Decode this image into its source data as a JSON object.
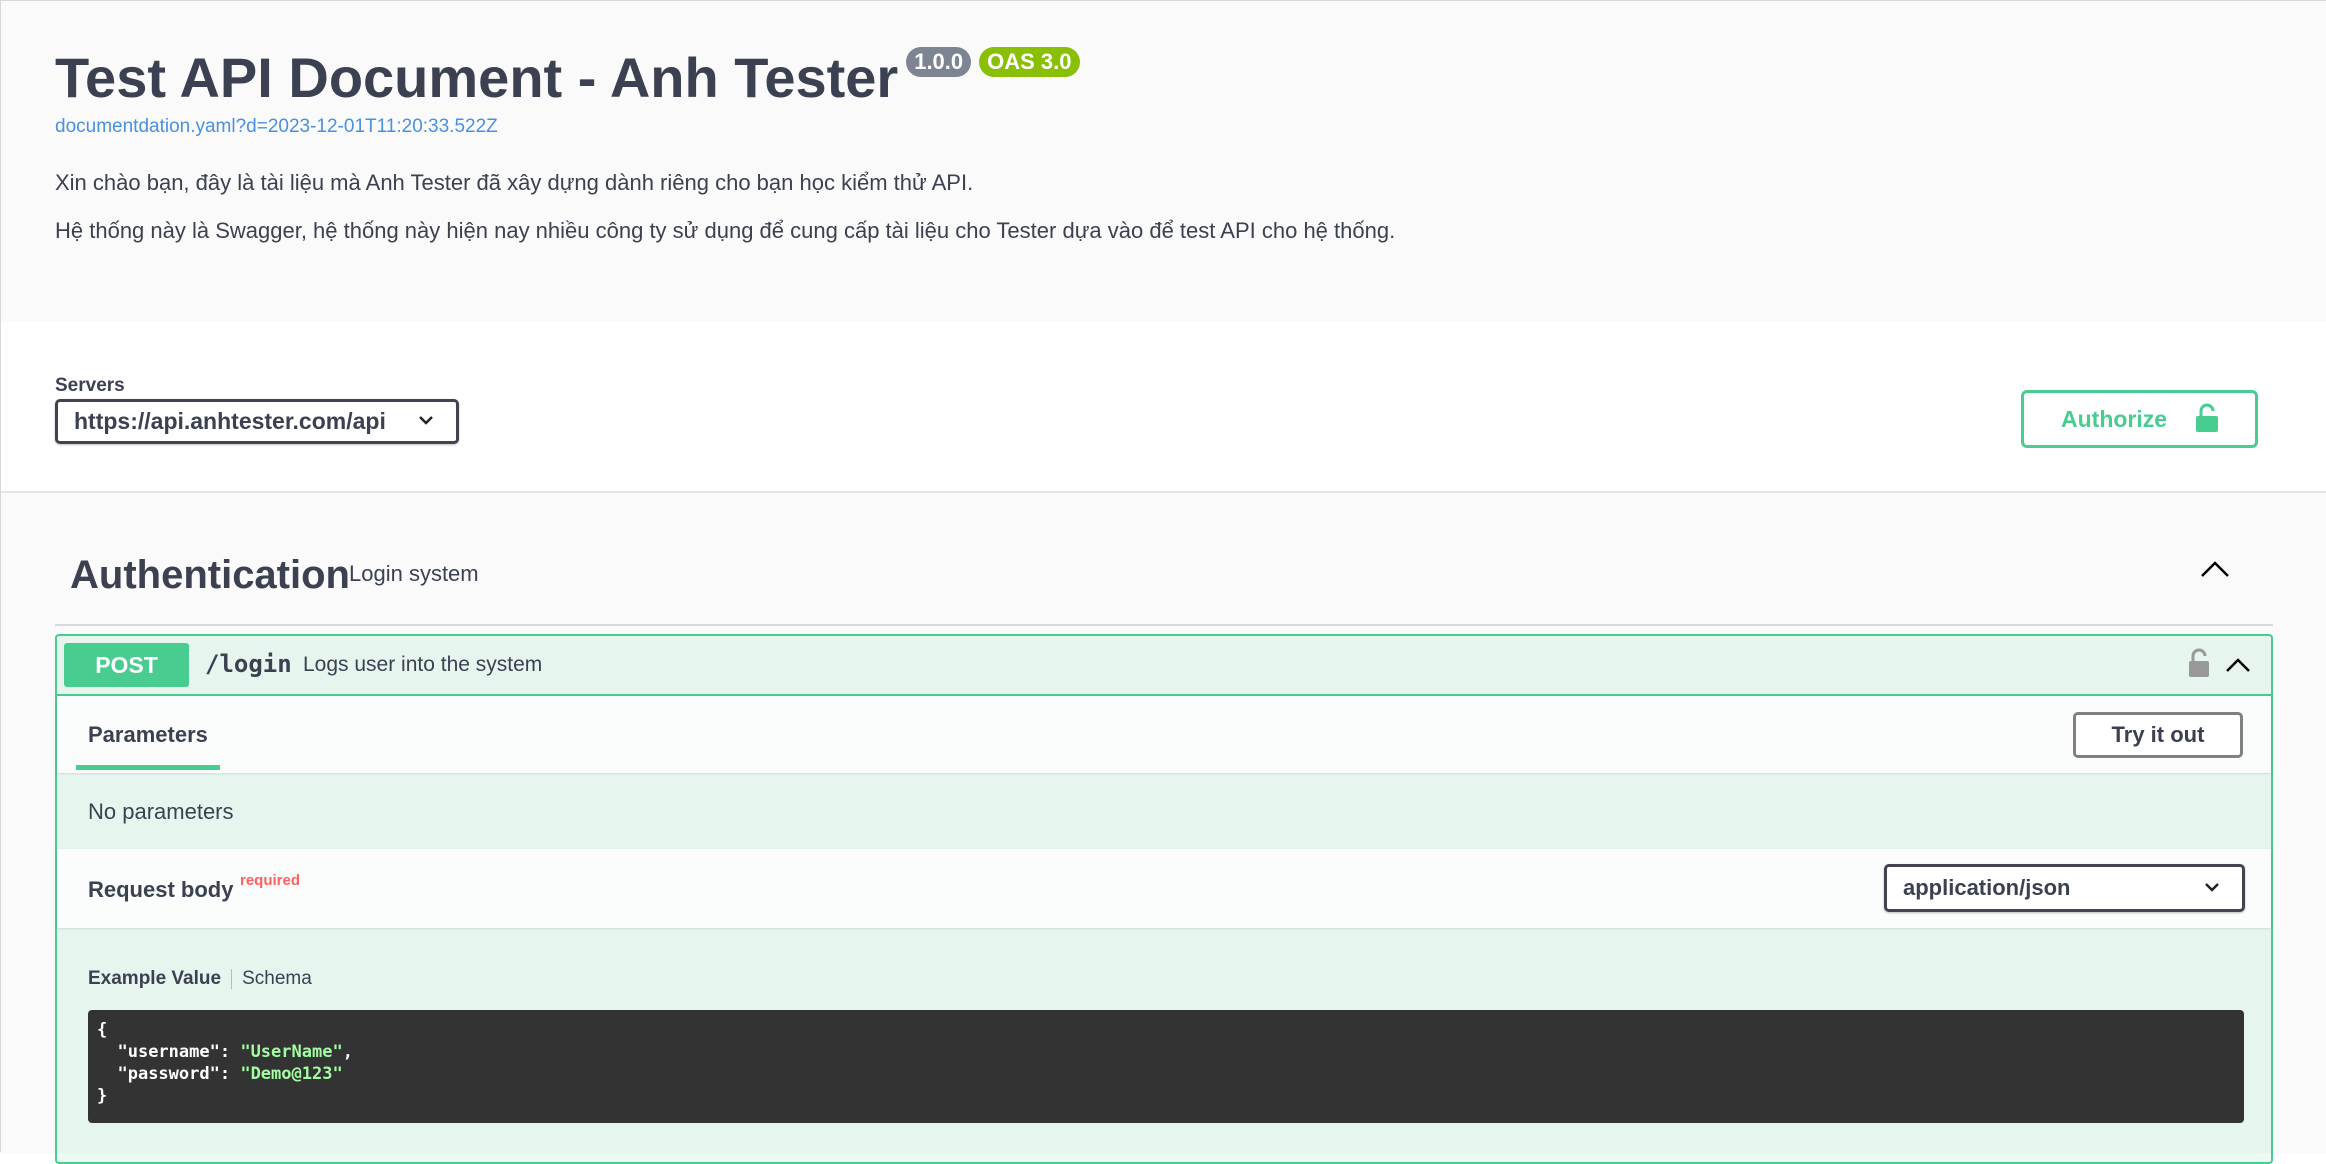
{
  "info": {
    "title": "Test API Document - Anh Tester",
    "version": "1.0.0",
    "oas": "OAS 3.0",
    "spec_link": "documentdation.yaml?d=2023-12-01T11:20:33.522Z",
    "description_lines": [
      "Xin chào bạn, đây là tài liệu mà Anh Tester đã xây dựng dành riêng cho bạn học kiểm thử API.",
      "Hệ thống này là Swagger, hệ thống này hiện nay nhiều công ty sử dụng để cung cấp tài liệu cho Tester dựa vào để test API cho hệ thống."
    ]
  },
  "scheme": {
    "servers_label": "Servers",
    "selected_server": "https://api.anhtester.com/api",
    "authorize_label": "Authorize"
  },
  "tag": {
    "name": "Authentication",
    "description": "Login system"
  },
  "operation": {
    "method": "POST",
    "path": "/login",
    "summary": "Logs user into the system",
    "parameters_tab": "Parameters",
    "try_it_out": "Try it out",
    "no_parameters": "No parameters",
    "request_body_title": "Request body",
    "required_label": "required",
    "content_type": "application/json",
    "example_tab": "Example Value",
    "schema_tab": "Schema",
    "example": {
      "open": "{",
      "username_key": "\"username\"",
      "username_value": "\"UserName\"",
      "password_key": "\"password\"",
      "password_value": "\"Demo@123\"",
      "close": "}"
    }
  },
  "colors": {
    "post": "#49cc90",
    "link": "#4990e2",
    "version_badge": "#7d8492",
    "oas_badge": "#89bf04",
    "required": "#ff6060"
  }
}
